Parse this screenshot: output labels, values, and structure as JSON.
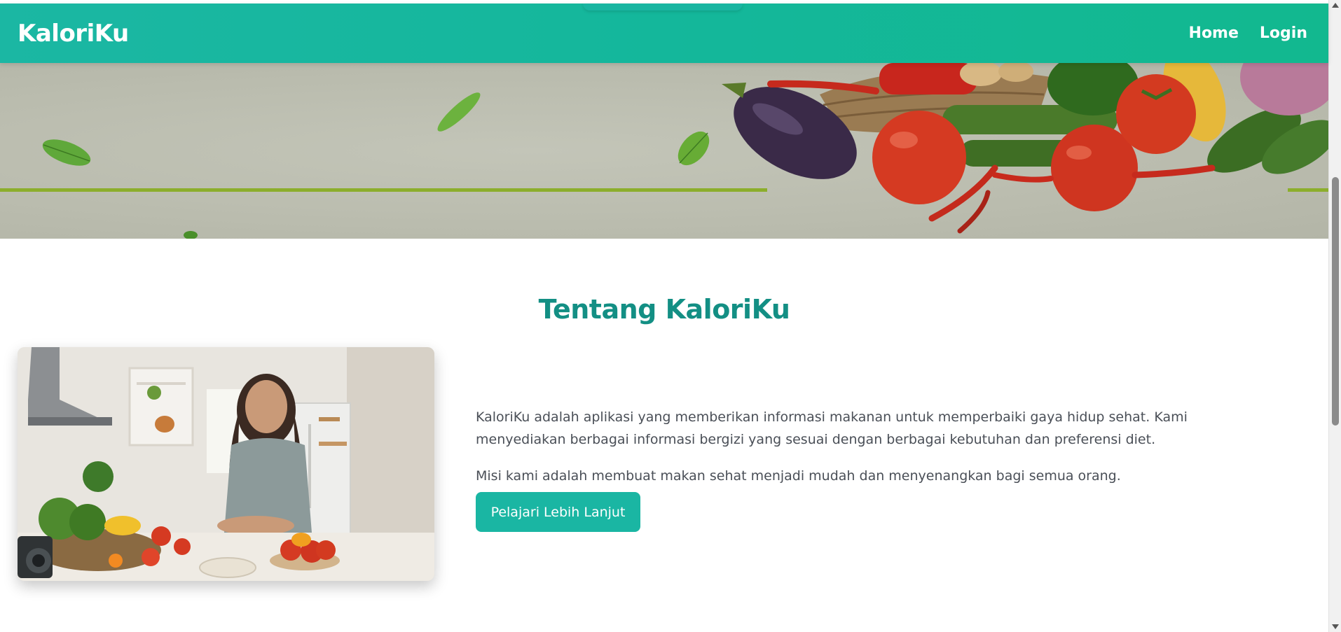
{
  "navbar": {
    "brand": "KaloriKu",
    "links": [
      "Home",
      "Login"
    ]
  },
  "about": {
    "title": "Tentang KaloriKu",
    "paragraph_1": "KaloriKu adalah aplikasi yang memberikan informasi makanan untuk memperbaiki gaya hidup sehat. Kami menyediakan berbagai informasi bergizi yang sesuai dengan berbagai kebutuhan dan preferensi diet.",
    "paragraph_2": "Misi kami adalah membuat makan sehat menjadi mudah dan menyenangkan bagi semua orang.",
    "button_label": "Pelajari Lebih Lanjut"
  },
  "colors": {
    "navbar": "#17b79c",
    "accent": "#1ab6a3",
    "title": "#138f84",
    "body_text": "#4a4f57"
  }
}
